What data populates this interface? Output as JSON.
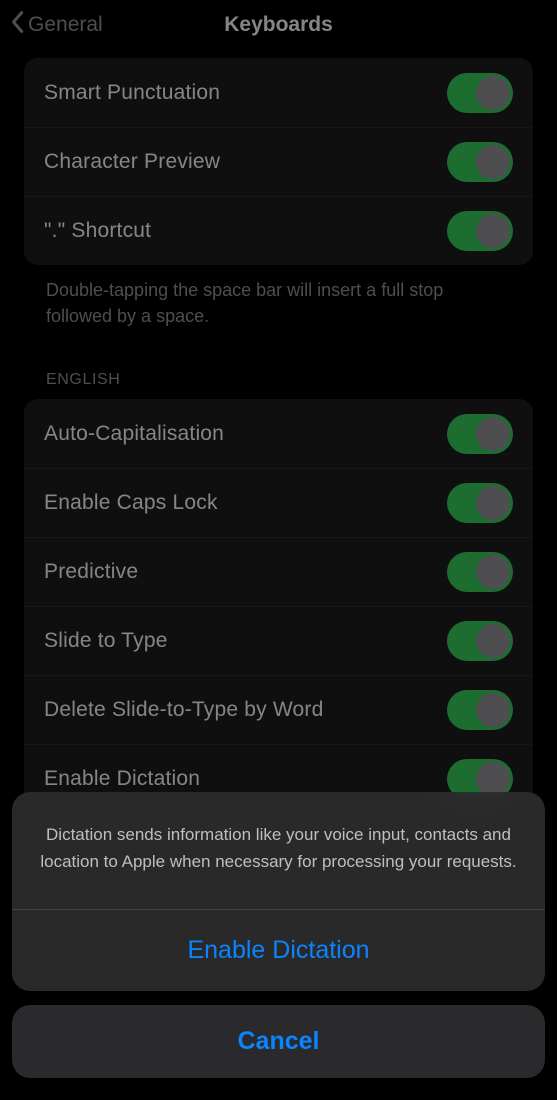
{
  "nav": {
    "back": "General",
    "title": "Keyboards"
  },
  "group1": {
    "items": [
      {
        "label": "Smart Punctuation"
      },
      {
        "label": "Character Preview"
      },
      {
        "label": "\".\" Shortcut"
      }
    ],
    "footer": "Double-tapping the space bar will insert a full stop followed by a space."
  },
  "group2": {
    "header": "English",
    "items": [
      {
        "label": "Auto-Capitalisation"
      },
      {
        "label": "Enable Caps Lock"
      },
      {
        "label": "Predictive"
      },
      {
        "label": "Slide to Type"
      },
      {
        "label": "Delete Slide-to-Type by Word"
      },
      {
        "label": "Enable Dictation"
      }
    ]
  },
  "sheet": {
    "message": "Dictation sends information like your voice input, contacts and location to Apple when necessary for processing your requests.",
    "action": "Enable Dictation",
    "cancel": "Cancel"
  }
}
